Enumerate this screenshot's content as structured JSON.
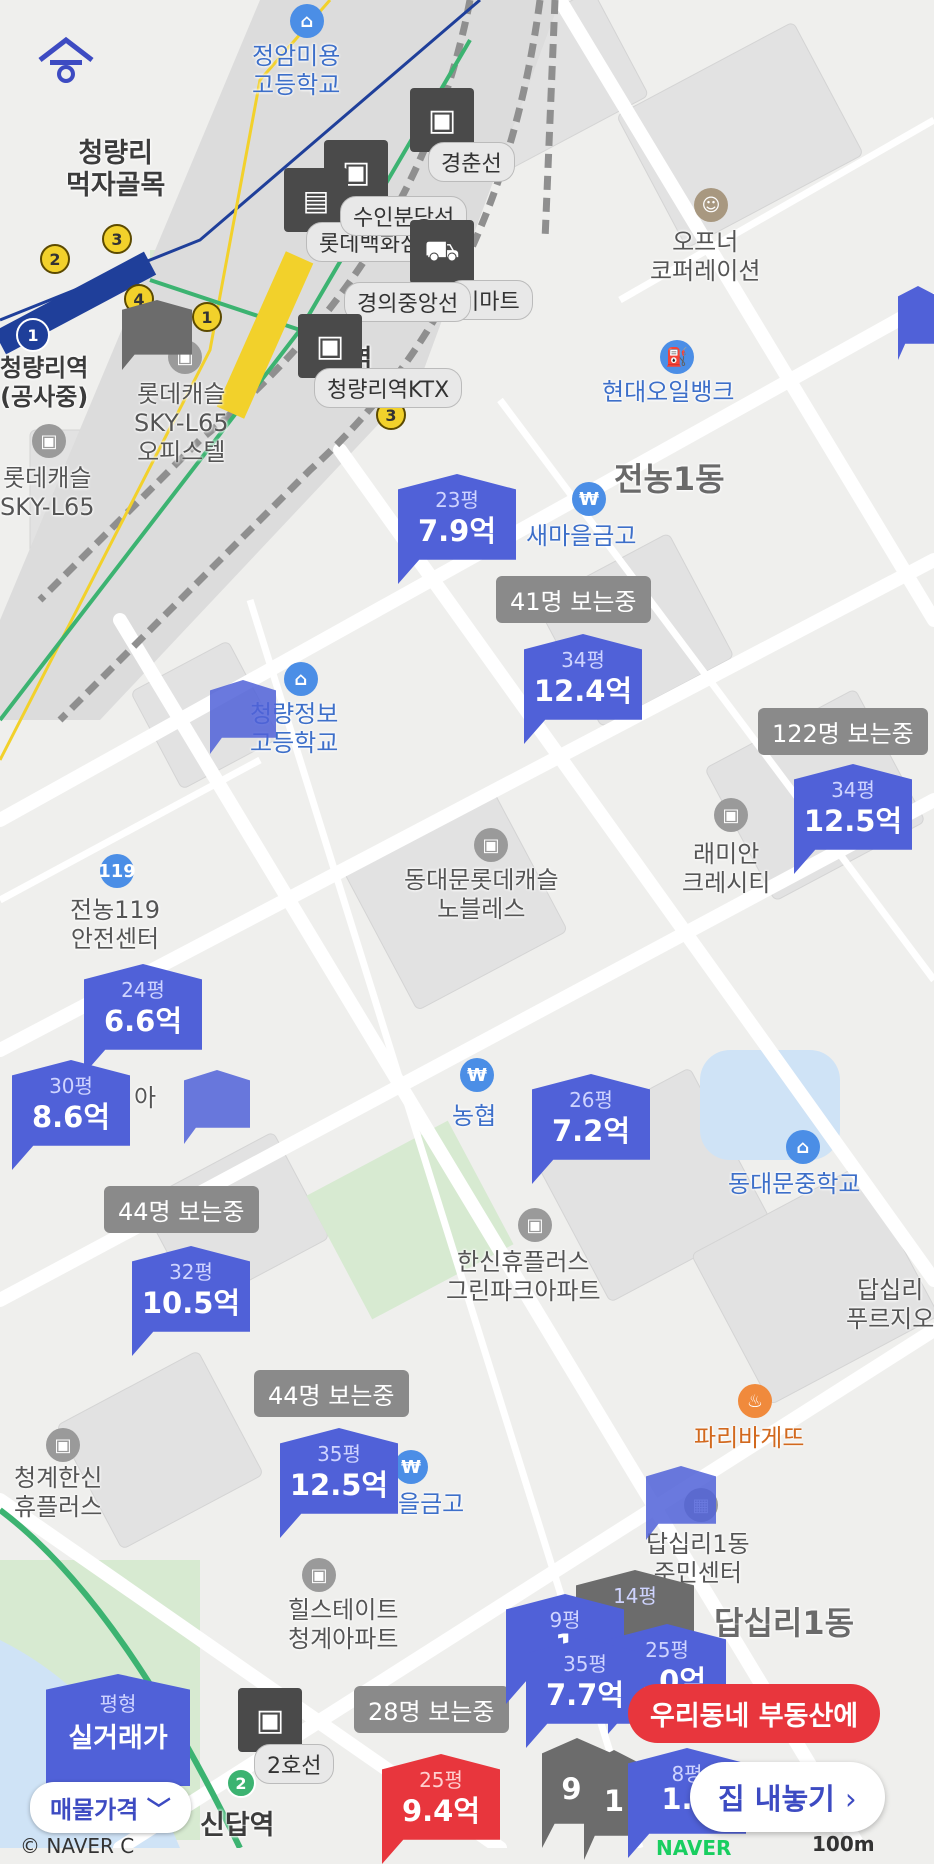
{
  "app_logo": "홈",
  "labels": {
    "jeongam_school": "정암미용\n고등학교",
    "cheongnyangni_food": "청량리\n먹자골목",
    "cheongnyangni_station": "청량리역\n(공사중)",
    "lotte_castle_l65_office": "롯데캐슬\nSKY-L65\n오피스텔",
    "lotte_castle_l65": "롯데캐슬\nSKY-L65",
    "offner": "오프너\n코퍼레이션",
    "hyundai_oilbank": "현대오일뱅크",
    "jeonnong1": "전농1동",
    "saemaul": "새마을금고",
    "cheongnyang_info_school": "청량정보\n고등학교",
    "raemian": "래미안\n크레시티",
    "lotte_noblesse": "동대문롯데캐슬\n노블레스",
    "jeonnong119": "전농119\n안전센터",
    "nonghyup": "농협",
    "dongdaemun_middle": "동대문중학교",
    "hanshin_huplus": "한신휴플러스\n그린파크아파트",
    "dapsimni_prugio": "답십리\n푸르지오",
    "paris_baguette": "파리바게뜨",
    "cheonggye_hanshin": "청계한신\n휴플러스",
    "saemaul2": "을금고",
    "dapsimni1_center": "답십리1동\n주민센터",
    "dapsimni1": "답십리1동",
    "hillstate": "힐스테이트\n청계아파트",
    "sindap_station": "신답역",
    "partial_a": "아",
    "partial_yeok": "역"
  },
  "stations": [
    {
      "name": "경춘선"
    },
    {
      "name": "수인분당선"
    },
    {
      "name": "롯데백화점"
    },
    {
      "name": "이마트"
    },
    {
      "name": "경의중앙선"
    },
    {
      "name": "청량리역KTX"
    },
    {
      "name": "2호선"
    }
  ],
  "watchers": [
    {
      "text": "41명 보는중"
    },
    {
      "text": "122명 보는중"
    },
    {
      "text": "44명 보는중"
    },
    {
      "text": "44명 보는중"
    },
    {
      "text": "28명 보는중"
    }
  ],
  "listings": [
    {
      "size": "23평",
      "price": "7.9억"
    },
    {
      "size": "34평",
      "price": "12.4억"
    },
    {
      "size": "34평",
      "price": "12.5억"
    },
    {
      "size": "24평",
      "price": "6.6억"
    },
    {
      "size": "30평",
      "price": "8.6억"
    },
    {
      "size": "26평",
      "price": "7.2억"
    },
    {
      "size": "32평",
      "price": "10.5억"
    },
    {
      "size": "35평",
      "price": "12.5억"
    },
    {
      "size": "9평",
      "price": "1"
    },
    {
      "size": "14평",
      "price": ""
    },
    {
      "size": "35평",
      "price": "7.7억"
    },
    {
      "size": "25평",
      "price": "1.0억"
    },
    {
      "size": "",
      "price": "9."
    },
    {
      "size": "",
      "price": "1"
    },
    {
      "size": "8평",
      "price": "1.5"
    },
    {
      "size": "25평",
      "price": "9.4억"
    }
  ],
  "bottom": {
    "type_label": "평형",
    "type_value": "실거래가",
    "filter_label": "매물가격",
    "cta_bubble": "우리동네 부동산에",
    "cta_button": "집 내놓기",
    "copyright": "© NAVER C",
    "scale": "100m",
    "naver": "NAVER"
  },
  "colors": {
    "pin_blue": "#5061d8",
    "pin_red": "#e8363d",
    "pin_grey": "#6c6c6c",
    "line1": "#1f3f9a",
    "line_green": "#3cb371",
    "line_yellow": "#f2d12b"
  }
}
